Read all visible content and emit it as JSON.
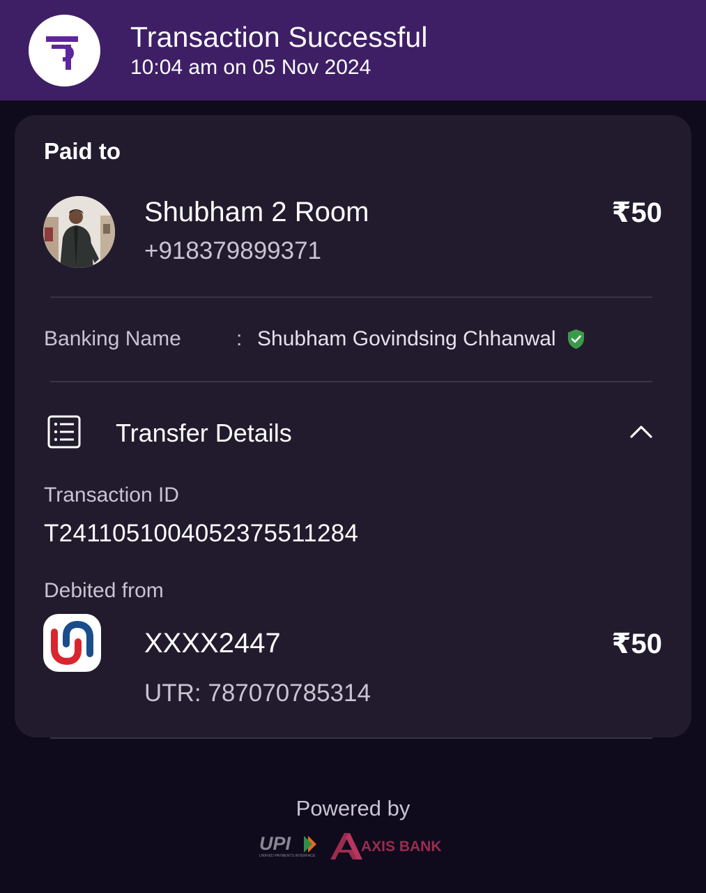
{
  "header": {
    "title": "Transaction Successful",
    "timestamp": "10:04 am on 05 Nov 2024",
    "app_logo_icon": "phonepe-logo-icon",
    "background": "#3e1f66"
  },
  "paid_to": {
    "heading": "Paid to",
    "name": "Shubham 2 Room",
    "phone": "+918379899371",
    "amount": "₹50",
    "avatar_icon": "profile-photo"
  },
  "banking": {
    "label": "Banking Name",
    "separator": ":",
    "value": "Shubham Govindsing Chhanwal",
    "verified_icon": "verified-shield-icon",
    "verified_color": "#3a9a4a"
  },
  "transfer_details": {
    "label": "Transfer Details",
    "icon": "receipt-list-icon",
    "toggle_icon": "chevron-up-icon",
    "transaction_id_label": "Transaction ID",
    "transaction_id": "T2411051004052375511284",
    "debited_from_label": "Debited from",
    "account": "XXXX2447",
    "amount": "₹50",
    "utr": "UTR: 787070785314",
    "bank_logo_icon": "union-bank-logo"
  },
  "footer": {
    "powered_by": "Powered by",
    "upi_logo": "UPI",
    "upi_tagline": "UNIFIED PAYMENTS INTERFACE",
    "partner_logo": "AXIS BANK",
    "partner_color": "#9c2c4f"
  }
}
